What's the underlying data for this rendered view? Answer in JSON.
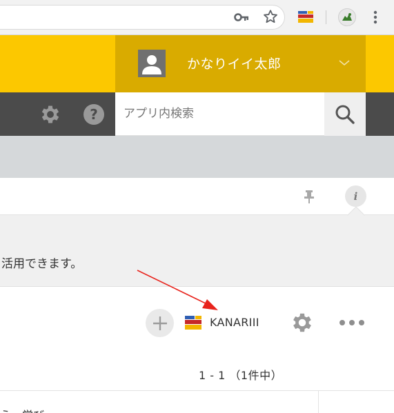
{
  "browser": {
    "toolbar_icons": [
      "key-icon",
      "star-icon",
      "extension-icon",
      "profile-avatar-icon",
      "menu-icon"
    ]
  },
  "header": {
    "user_name": "かなりイイ太郎",
    "accent_color": "#fcc800",
    "user_area_color": "#d9ab00"
  },
  "toolbar": {
    "search_placeholder": "アプリ内検索",
    "icons": [
      "gear-icon",
      "help-icon",
      "search-icon"
    ]
  },
  "description": {
    "text": "活用できます。"
  },
  "actions": {
    "plugin_label": "KANARIII",
    "icons": [
      "plus-icon",
      "kanari-logo-icon",
      "gear-icon",
      "more-icon"
    ]
  },
  "pagination": {
    "text": "1 - 1 （1件中）"
  },
  "table": {
    "first_row_partial": "え　学び"
  },
  "annotation": {
    "arrow_color": "#e8231c"
  }
}
